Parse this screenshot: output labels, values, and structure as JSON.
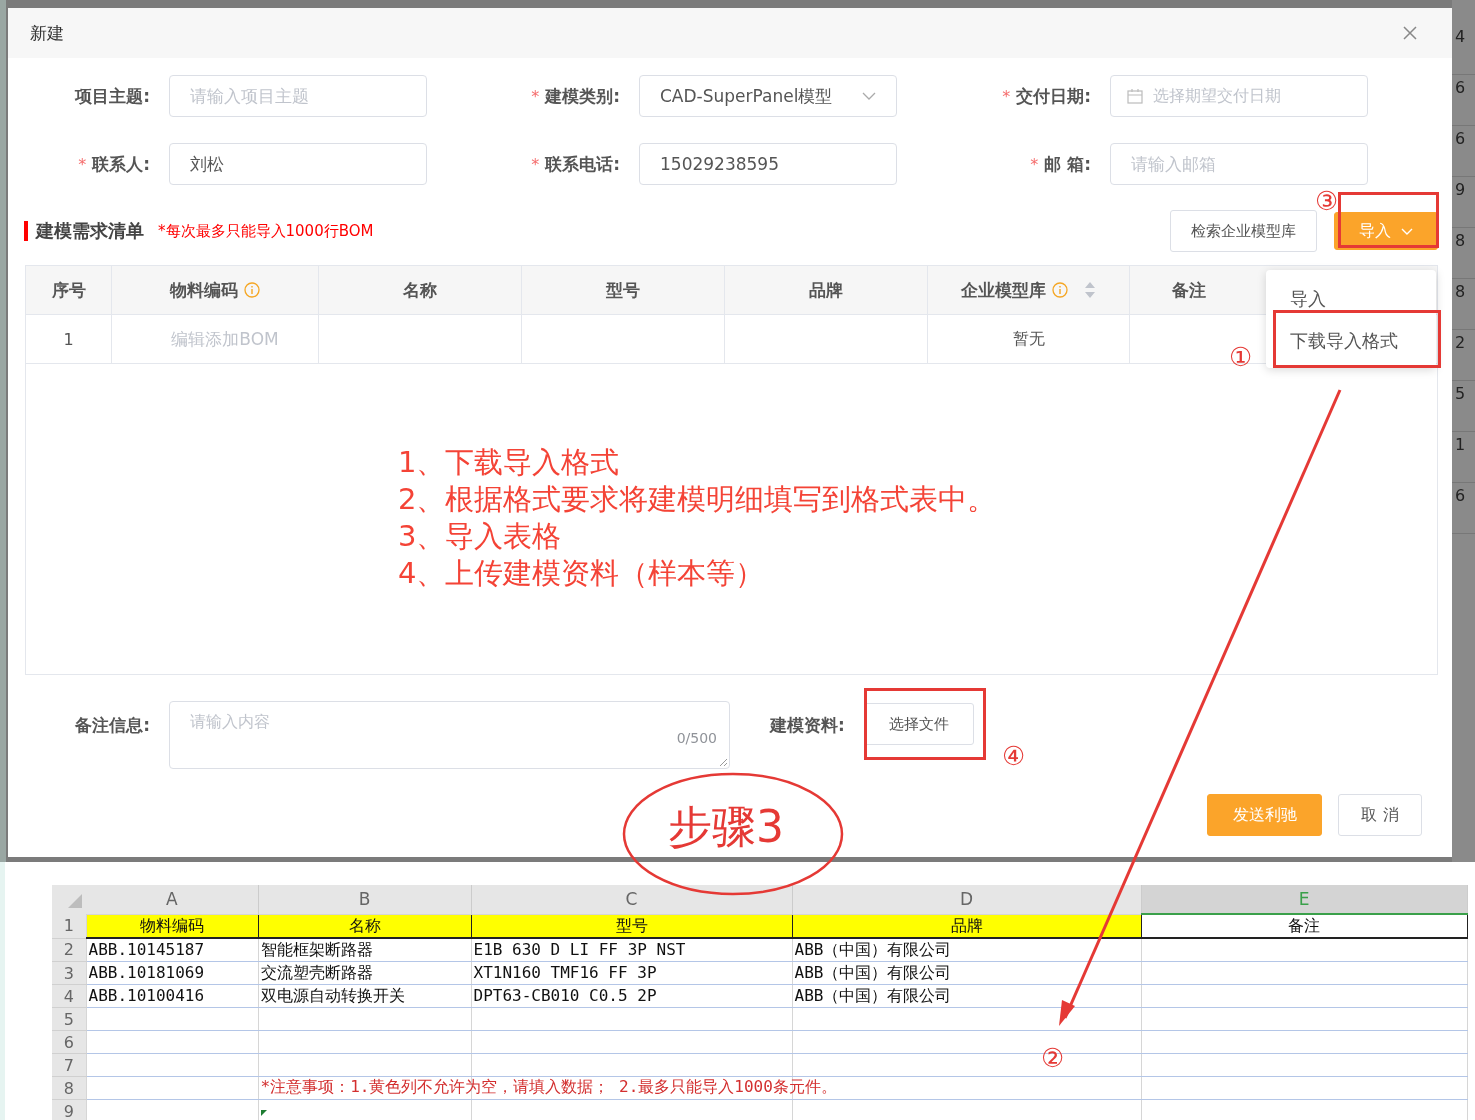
{
  "dialog": {
    "title": "新建"
  },
  "form_fields": [
    {
      "label": "项目主题:",
      "kind": "text",
      "placeholder": "请输入项目主题"
    },
    {
      "label": "建模类别:",
      "kind": "select",
      "required_mark": "*",
      "value": "CAD-SuperPanel模型"
    },
    {
      "label": "交付日期:",
      "kind": "date",
      "required_mark": "*",
      "placeholder": "选择期望交付日期"
    },
    {
      "label": "联系人:",
      "kind": "text",
      "required_mark": "*",
      "value": "刘松"
    },
    {
      "label": "联系电话:",
      "kind": "text",
      "required_mark": "*",
      "value": "15029238595"
    },
    {
      "label": "邮 箱:",
      "kind": "text",
      "required_mark": "*",
      "placeholder": "请输入邮箱"
    }
  ],
  "section": {
    "title": "建模需求清单",
    "note": "*每次最多只能导入1000行BOM"
  },
  "toolbar": {
    "search_button": "检索企业模型库",
    "import_button": "导入"
  },
  "import_menu": {
    "items": [
      "导入",
      "下载导入格式"
    ]
  },
  "table": {
    "columns": [
      {
        "label": "序号"
      },
      {
        "label": "物料编码",
        "info": true
      },
      {
        "label": "名称"
      },
      {
        "label": "型号"
      },
      {
        "label": "品牌"
      },
      {
        "label": "企业模型库",
        "info": true,
        "sortable": true
      },
      {
        "label": "备注"
      }
    ],
    "rows": [
      {
        "index": "1",
        "code_placeholder": "编辑添加BOM",
        "library": "暂无"
      }
    ]
  },
  "instructions": [
    "1、下载导入格式",
    "2、根据格式要求将建模明细填写到格式表中。",
    "3、导入表格",
    "4、上传建模资料（样本等）"
  ],
  "remark": {
    "label": "备注信息:",
    "placeholder": "请输入内容",
    "counter": "0/500"
  },
  "upload": {
    "label": "建模资料:",
    "button": "选择文件"
  },
  "footer_buttons": [
    {
      "label": "发送利驰",
      "primary": true
    },
    {
      "label": "取 消",
      "primary": false
    }
  ],
  "annotations": {
    "step_label": "步骤3",
    "markers": [
      "③",
      "①",
      "④",
      "②"
    ]
  },
  "background_digits": [
    "4",
    "6",
    "6",
    "9",
    "8",
    "8",
    "2",
    "5",
    "1",
    "6"
  ],
  "spreadsheet": {
    "columns": [
      {
        "letter": "A",
        "selected": false
      },
      {
        "letter": "B",
        "selected": false
      },
      {
        "letter": "C",
        "selected": false
      },
      {
        "letter": "D",
        "selected": false
      },
      {
        "letter": "E",
        "selected": true
      }
    ],
    "header_row": [
      {
        "text": "物料编码",
        "required": true
      },
      {
        "text": "名称",
        "required": true
      },
      {
        "text": "型号",
        "required": true
      },
      {
        "text": "品牌",
        "required": true
      },
      {
        "text": "备注",
        "required": false
      }
    ],
    "rows": [
      [
        "ABB.10145187",
        "智能框架断路器",
        "E1B 630 D LI FF 3P NST",
        "ABB（中国）有限公司"
      ],
      [
        "ABB.10181069",
        "交流塑壳断路器",
        "XT1N160 TMF16 FF 3P",
        "ABB（中国）有限公司"
      ],
      [
        "ABB.10100416",
        "双电源自动转换开关",
        "DPT63-CB010 C0.5 2P",
        "ABB（中国）有限公司"
      ]
    ],
    "row_numbers": [
      "1",
      "2",
      "3",
      "4",
      "5",
      "6",
      "7",
      "8",
      "9"
    ],
    "note": "*注意事项：1.黄色列不允许为空，请填入数据； 2.最多只能导入1000条元件。"
  }
}
